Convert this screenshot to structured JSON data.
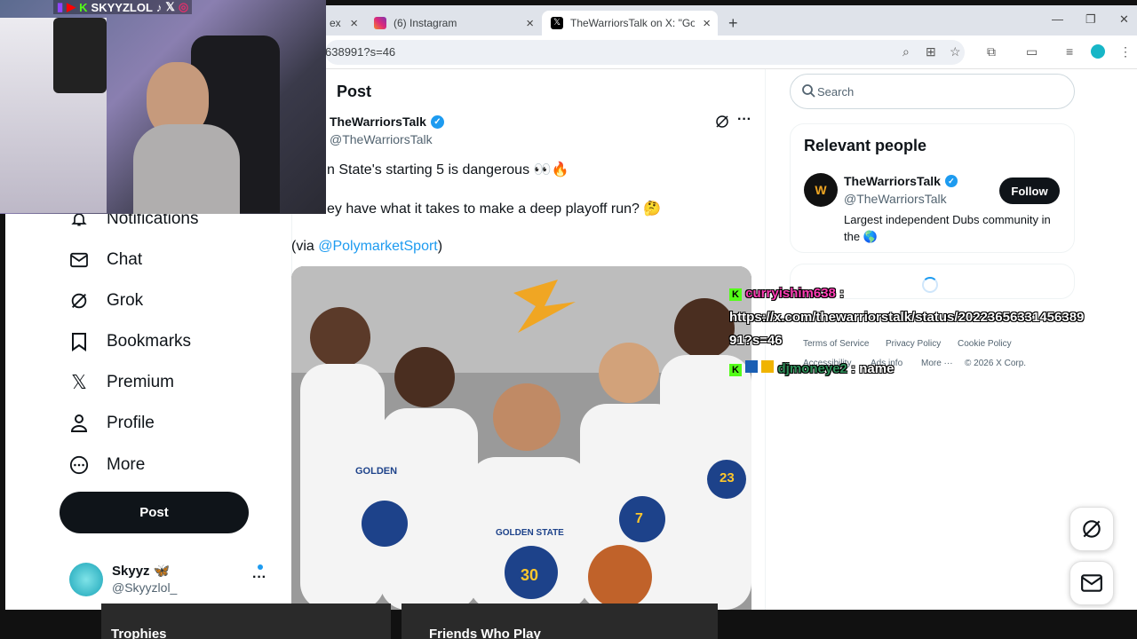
{
  "browser": {
    "tabs": [
      {
        "title": "ex",
        "partial": true
      },
      {
        "title": "(6) Instagram"
      },
      {
        "title": "TheWarriorsTalk on X: \"Golden"
      }
    ],
    "new_tab": "+",
    "url": "638991?s=46"
  },
  "overlay": {
    "socials": "SKYYZLOL"
  },
  "sidebar": {
    "items": [
      {
        "label": "Notifications",
        "icon": "bell-icon"
      },
      {
        "label": "Chat",
        "icon": "mail-icon"
      },
      {
        "label": "Grok",
        "icon": "grok-icon"
      },
      {
        "label": "Bookmarks",
        "icon": "bookmark-icon"
      },
      {
        "label": "Premium",
        "icon": "x-logo-icon"
      },
      {
        "label": "Profile",
        "icon": "person-icon"
      },
      {
        "label": "More",
        "icon": "more-circle-icon"
      }
    ],
    "post_button": "Post",
    "account": {
      "name": "Skyyz 🦋",
      "handle": "@Skyyzlol_",
      "more": "···"
    }
  },
  "main": {
    "header": "Post",
    "tweet": {
      "author": "TheWarriorsTalk",
      "handle": "@TheWarriorsTalk",
      "line1": "n State's starting 5 is dangerous 👀🔥",
      "line2": "ey have what it takes to make a deep playoff run? 🤔",
      "via_prefix": "(via ",
      "via_link": "@PolymarketSport",
      "via_suffix": ")",
      "more": "···"
    },
    "image_jerseys": [
      "GOLDEN",
      "GOLDEN STATE",
      "30",
      "7",
      "23"
    ]
  },
  "right": {
    "search_placeholder": "Search",
    "relevant": {
      "title": "Relevant people",
      "name": "TheWarriorsTalk",
      "handle": "@TheWarriorsTalk",
      "bio": "Largest independent Dubs community in the 🌎",
      "follow": "Follow"
    },
    "footer": {
      "links": [
        "Terms of Service",
        "Privacy Policy",
        "Cookie Policy",
        "Accessibility",
        "Ads info",
        "More ···"
      ],
      "copyright": "© 2026 X Corp."
    }
  },
  "chat": {
    "msg1_user": "curryishim638",
    "msg1_text_a": "https://x.com/thewarriorstalk/status/20223656331456389",
    "msg1_text_b": "91?s=46",
    "msg2_user": "djmoneye2",
    "msg2_text": "name"
  },
  "bottom": {
    "left": "Trophies",
    "right": "Friends Who Play"
  },
  "colors": {
    "x_blue": "#1d9bf0",
    "chat_user": "#ff3eb5",
    "chat_user2": "#2f8f5a",
    "kick_green": "#53fc18"
  }
}
